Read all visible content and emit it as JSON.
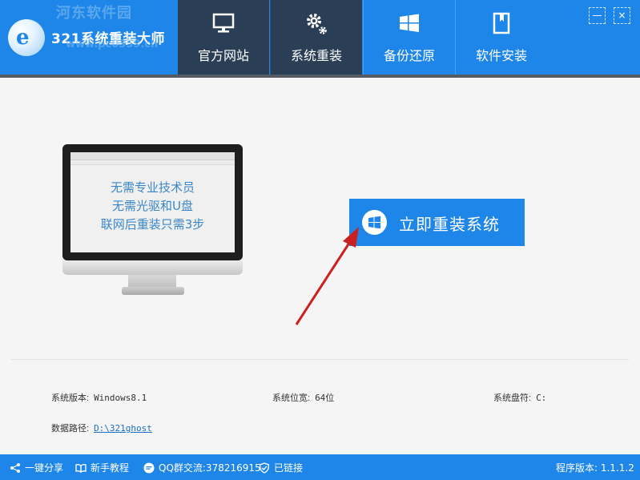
{
  "app": {
    "title": "321系统重装大师",
    "watermark_top": "河东软件园",
    "watermark_bottom": "www.pc0359.cn",
    "logo_letter": "e"
  },
  "nav": {
    "tabs": [
      {
        "label": "官方网站",
        "icon": "monitor-icon"
      },
      {
        "label": "系统重装",
        "icon": "gears-icon"
      },
      {
        "label": "备份还原",
        "icon": "windows-logo-icon"
      },
      {
        "label": "软件安装",
        "icon": "book-icon"
      }
    ]
  },
  "window": {
    "minimize_glyph": "—",
    "close_glyph": "×"
  },
  "monitor": {
    "lines": [
      "无需专业技术员",
      "无需光驱和U盘",
      "联网后重装只需3步"
    ]
  },
  "action": {
    "reinstall_label": "立即重装系统"
  },
  "system_info": {
    "version_label": "系统版本:",
    "version_value": "Windows8.1",
    "bits_label": "系统位宽:",
    "bits_value": "64位",
    "drive_label": "系统盘符:",
    "drive_value": "C:",
    "path_label": "数据路径:",
    "path_value": "D:\\321ghost"
  },
  "statusbar": {
    "share": "一键分享",
    "tutorial": "新手教程",
    "qq": "QQ群交流:378216915",
    "connected": "已链接",
    "program_version": "程序版本: 1.1.1.2"
  },
  "colors": {
    "accent": "#1e86e8",
    "nav_dark": "#2a3f55",
    "arrow": "#cc1f1f",
    "monitor_text": "#3a86c8"
  }
}
